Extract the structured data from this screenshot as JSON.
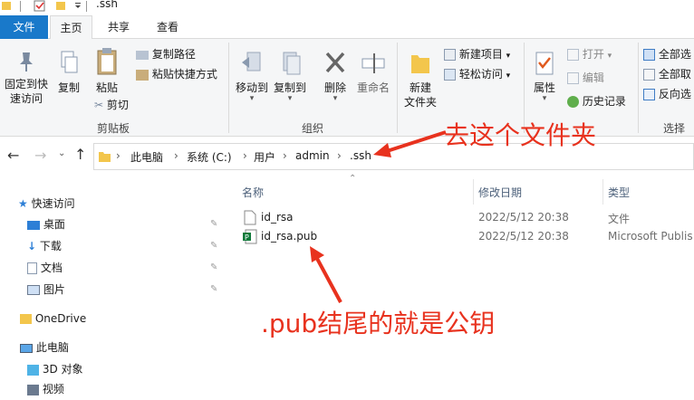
{
  "window": {
    "title": ".ssh"
  },
  "ribbon_tabs": [
    "文件",
    "主页",
    "共享",
    "查看"
  ],
  "ribbon": {
    "clipboard": {
      "pin_label": "固定到快\n速访问",
      "copy_label": "复制",
      "paste_label": "粘贴",
      "copy_path_label": "复制路径",
      "paste_shortcut_label": "粘贴快捷方式",
      "cut_label": "剪切",
      "group_label": "剪贴板"
    },
    "organize": {
      "move_to_label": "移动到",
      "copy_to_label": "复制到",
      "delete_label": "删除",
      "rename_label": "重命名",
      "group_label": "组织"
    },
    "new": {
      "new_folder_label": "新建\n文件夹",
      "new_item_label": "新建项目",
      "easy_access_label": "轻松访问"
    },
    "open": {
      "properties_label": "属性",
      "open_label": "打开",
      "edit_label": "编辑",
      "history_label": "历史记录"
    },
    "select": {
      "select_all_label": "全部选",
      "select_none_label": "全部取",
      "invert_label": "反向选",
      "group_label": "选择"
    }
  },
  "breadcrumb": [
    "此电脑",
    "系统 (C:)",
    "用户",
    "admin",
    ".ssh"
  ],
  "nav": {
    "quick_access": "快速访问",
    "items": [
      "桌面",
      "下载",
      "文档",
      "图片"
    ],
    "onedrive": "OneDrive",
    "this_pc": "此电脑",
    "objects3d": "3D 对象",
    "videos": "视频"
  },
  "columns": {
    "name": "名称",
    "modified": "修改日期",
    "type": "类型"
  },
  "files": [
    {
      "name": "id_rsa",
      "modified": "2022/5/12 20:38",
      "type": "文件"
    },
    {
      "name": "id_rsa.pub",
      "modified": "2022/5/12 20:38",
      "type": "Microsoft Publis"
    }
  ],
  "annotations": {
    "go_to_folder": "去这个文件夹",
    "pub_is_public_key": ".pub结尾的就是公钥"
  },
  "colors": {
    "accent": "#1979ca",
    "annotation": "#e8321e",
    "folder": "#f3c64c"
  }
}
